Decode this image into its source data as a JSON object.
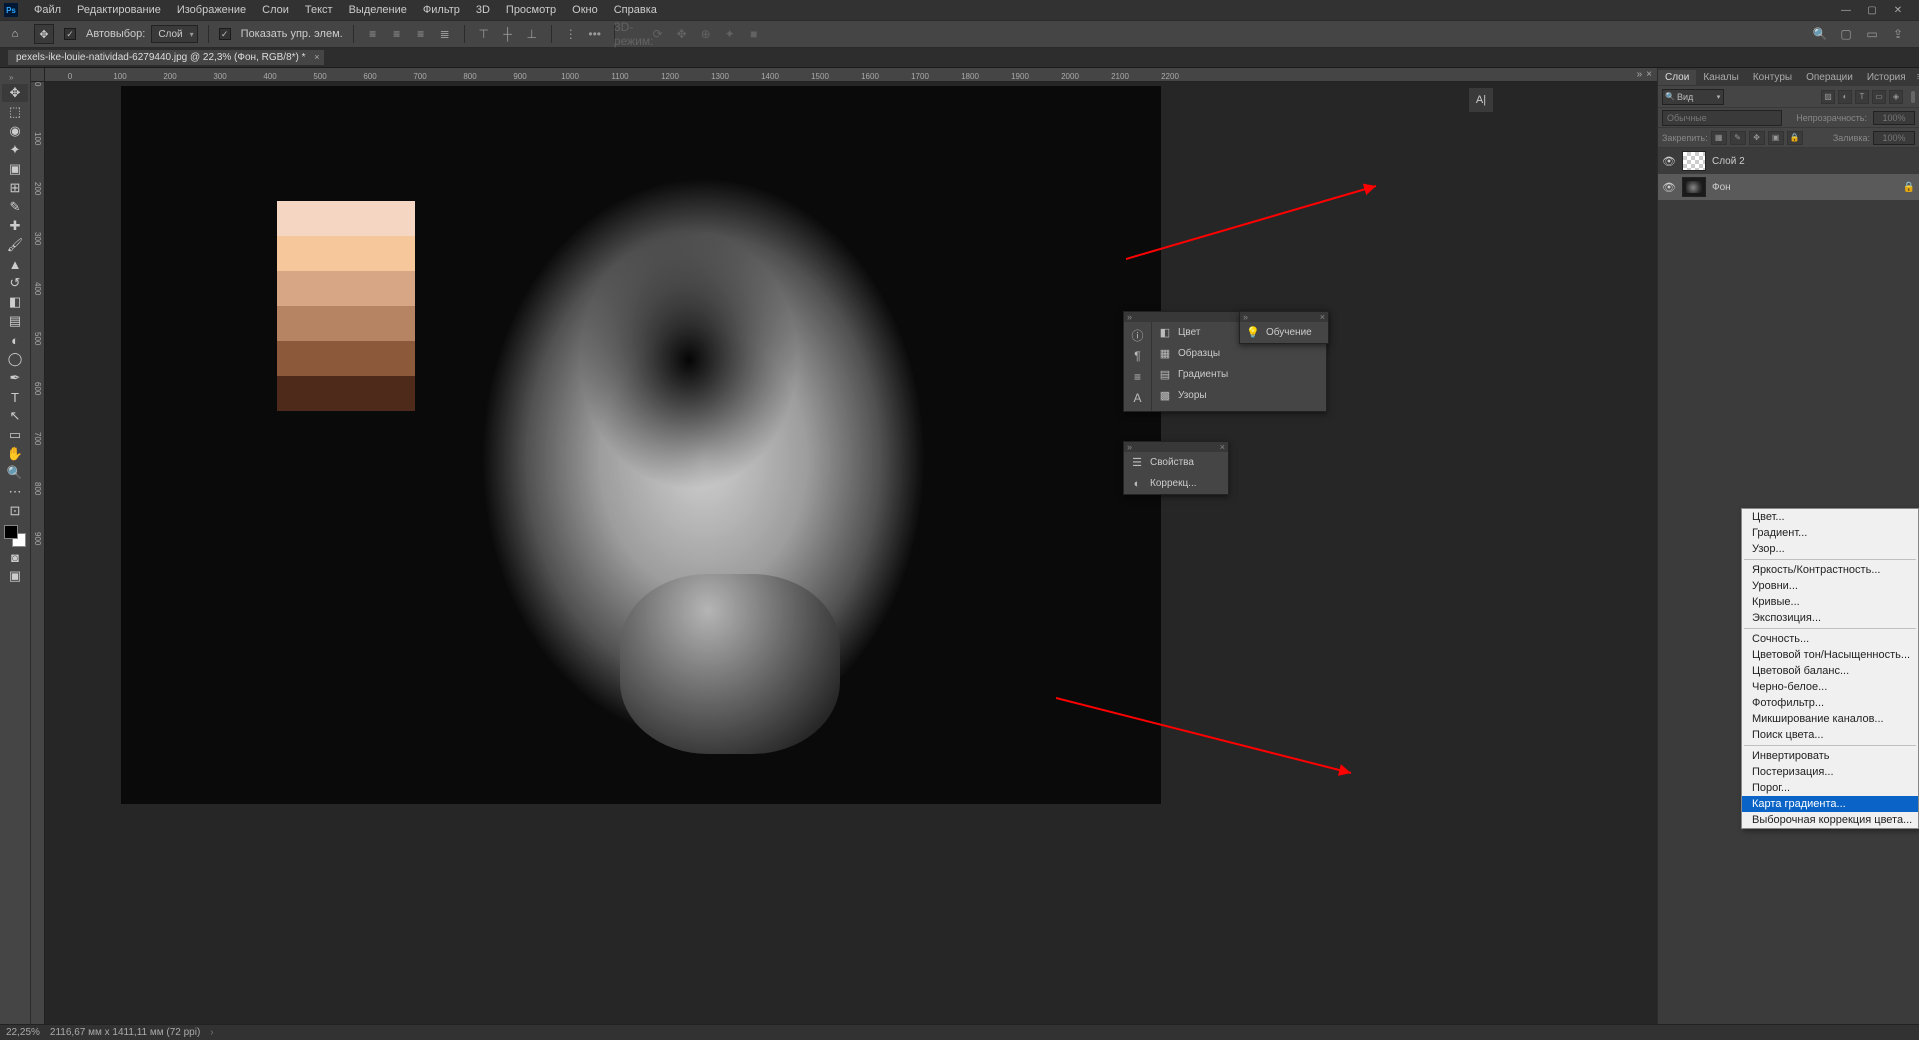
{
  "menubar": {
    "items": [
      "Файл",
      "Редактирование",
      "Изображение",
      "Слои",
      "Текст",
      "Выделение",
      "Фильтр",
      "3D",
      "Просмотр",
      "Окно",
      "Справка"
    ]
  },
  "optionsbar": {
    "auto_select": "Автовыбор:",
    "layer_select": "Слой",
    "show_controls": "Показать упр. элем.",
    "mode3d": "3D-режим:"
  },
  "document": {
    "tab_title": "pexels-ike-louie-natividad-6279440.jpg @ 22,3% (Фон, RGB/8*) *"
  },
  "ruler_h": [
    "0",
    "100",
    "200",
    "300",
    "400",
    "500",
    "600",
    "700",
    "800",
    "900",
    "1000",
    "1100",
    "1200",
    "1300",
    "1400",
    "1500",
    "1600",
    "1700",
    "1800",
    "1900",
    "2000",
    "2100",
    "2200"
  ],
  "ruler_v": [
    "0",
    "100",
    "200",
    "300",
    "400",
    "500",
    "600",
    "700",
    "800",
    "900"
  ],
  "ai_badge": "A|",
  "palette_colors": [
    "#f4d6c2",
    "#f5c79a",
    "#d7a785",
    "#b78463",
    "#8c5a3a",
    "#4e2a1b"
  ],
  "panels": {
    "tabs": [
      "Слои",
      "Каналы",
      "Контуры",
      "Операции",
      "История"
    ],
    "filter_kind": "Вид",
    "blend_mode": "Обычные",
    "opacity_label": "Непрозрачность:",
    "opacity_value": "100%",
    "lock_label": "Закрепить:",
    "fill_label": "Заливка:",
    "fill_value": "100%",
    "layers": [
      {
        "name": "Слой 2",
        "locked": false,
        "thumb": "checker"
      },
      {
        "name": "Фон",
        "locked": true,
        "thumb": "dark"
      }
    ]
  },
  "float1": {
    "left_items": [
      "Цвет",
      "Образцы",
      "Градиенты",
      "Узоры"
    ],
    "right_item": "Обучение"
  },
  "float2": {
    "items": [
      "Свойства",
      "Коррекц..."
    ]
  },
  "context_menu": {
    "groups": [
      [
        "Цвет...",
        "Градиент...",
        "Узор..."
      ],
      [
        "Яркость/Контрастность...",
        "Уровни...",
        "Кривые...",
        "Экспозиция..."
      ],
      [
        "Сочность...",
        "Цветовой тон/Насыщенность...",
        "Цветовой баланс...",
        "Черно-белое...",
        "Фотофильтр...",
        "Микширование каналов...",
        "Поиск цвета..."
      ],
      [
        "Инвертировать",
        "Постеризация...",
        "Порог...",
        "Карта градиента...",
        "Выборочная коррекция цвета..."
      ]
    ],
    "highlighted": "Карта градиента..."
  },
  "statusbar": {
    "zoom": "22,25%",
    "dims": "2116,67 мм x 1411,11 мм (72 ppi)"
  }
}
